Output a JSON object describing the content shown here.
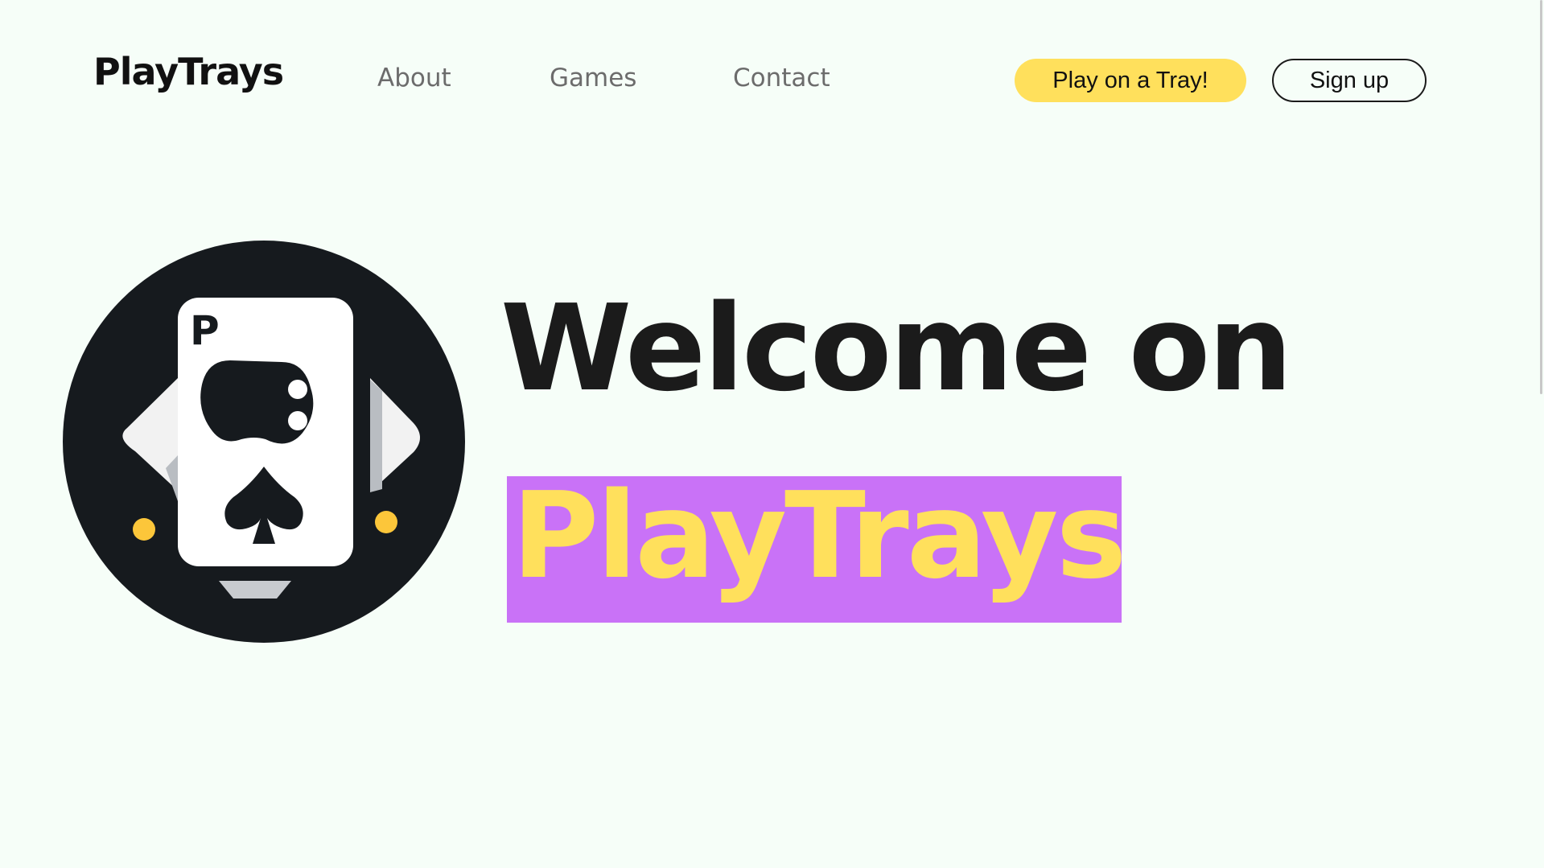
{
  "header": {
    "brand": "PlayTrays",
    "nav": [
      {
        "label": "About"
      },
      {
        "label": "Games"
      },
      {
        "label": "Contact"
      }
    ],
    "cta_primary": "Play on a Tray!",
    "cta_secondary": "Sign up"
  },
  "logo": {
    "icon": "playing-card-gamepad-logo",
    "card_letter": "P"
  },
  "hero": {
    "line1": "Welcome on",
    "line2": "PlayTrays"
  },
  "colors": {
    "background": "#f6fef8",
    "accent_yellow": "#ffe05c",
    "accent_purple": "#c972f7",
    "dark": "#1b1b1b"
  }
}
